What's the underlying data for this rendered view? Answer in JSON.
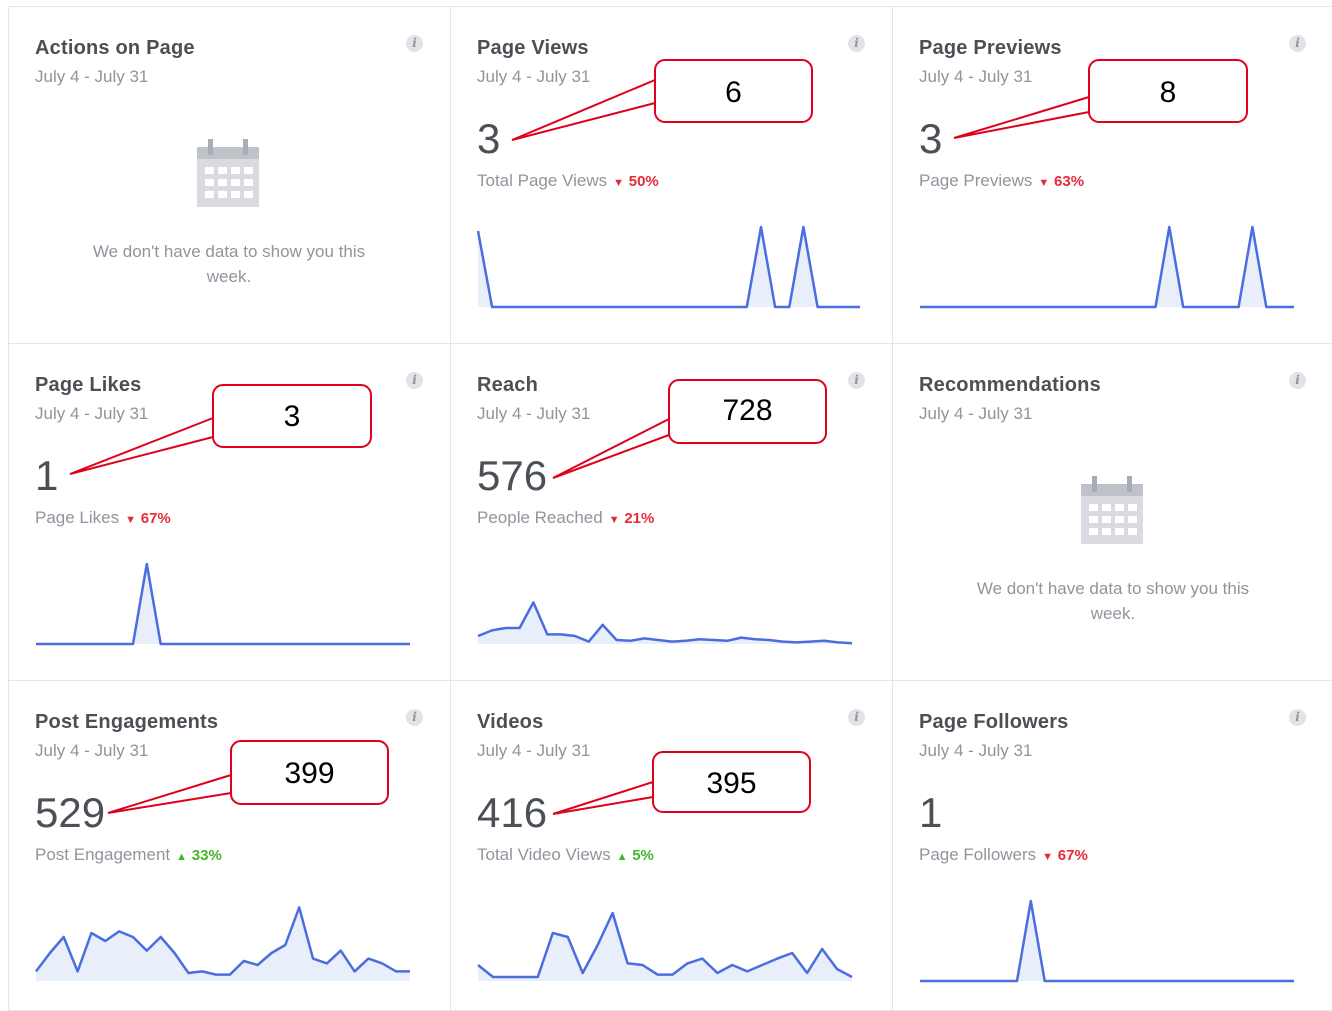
{
  "date_range": "July 4 - July 31",
  "info_glyph": "i",
  "empty_message": "We don't have data to show you this week.",
  "colors": {
    "line": "#4a6ee0",
    "down": "#e52b38",
    "up": "#42b72a",
    "callout": "#e0001b"
  },
  "cards": [
    {
      "id": "actions",
      "title": "Actions on Page",
      "empty": true
    },
    {
      "id": "views",
      "title": "Page Views",
      "value": "3",
      "metric": "Total Page Views",
      "direction": "down",
      "change": "50%",
      "series": [
        0.95,
        0,
        0,
        0,
        0,
        0,
        0,
        0,
        0,
        0,
        0,
        0,
        0,
        0,
        0,
        0,
        0,
        0,
        0,
        0,
        1,
        0,
        0,
        1,
        0,
        0,
        0,
        0
      ]
    },
    {
      "id": "previews",
      "title": "Page Previews",
      "value": "3",
      "metric": "Page Previews",
      "direction": "down",
      "change": "63%",
      "series": [
        0,
        0,
        0,
        0,
        0,
        0,
        0,
        0,
        0,
        0,
        0,
        0,
        0,
        0,
        0,
        0,
        0,
        0,
        1,
        0,
        0,
        0,
        0,
        0,
        1,
        0,
        0,
        0
      ]
    },
    {
      "id": "likes",
      "title": "Page Likes",
      "value": "1",
      "metric": "Page Likes",
      "direction": "down",
      "change": "67%",
      "series": [
        0,
        0,
        0,
        0,
        0,
        0,
        0,
        0,
        1,
        0,
        0,
        0,
        0,
        0,
        0,
        0,
        0,
        0,
        0,
        0,
        0,
        0,
        0,
        0,
        0,
        0,
        0,
        0
      ]
    },
    {
      "id": "reach",
      "title": "Reach",
      "value": "576",
      "metric": "People Reached",
      "direction": "down",
      "change": "21%",
      "series": [
        0.1,
        0.17,
        0.2,
        0.2,
        0.52,
        0.12,
        0.12,
        0.1,
        0.03,
        0.24,
        0.05,
        0.04,
        0.07,
        0.05,
        0.03,
        0.04,
        0.06,
        0.05,
        0.04,
        0.08,
        0.06,
        0.05,
        0.03,
        0.02,
        0.03,
        0.04,
        0.02,
        0.01
      ]
    },
    {
      "id": "recommendations",
      "title": "Recommendations",
      "empty": true
    },
    {
      "id": "engagements",
      "title": "Post Engagements",
      "value": "529",
      "metric": "Post Engagement",
      "direction": "up",
      "change": "33%",
      "series": [
        0.12,
        0.35,
        0.55,
        0.12,
        0.6,
        0.5,
        0.62,
        0.55,
        0.38,
        0.55,
        0.35,
        0.1,
        0.12,
        0.08,
        0.08,
        0.25,
        0.2,
        0.35,
        0.45,
        0.92,
        0.28,
        0.22,
        0.38,
        0.12,
        0.28,
        0.22,
        0.12,
        0.12
      ]
    },
    {
      "id": "videos",
      "title": "Videos",
      "value": "416",
      "metric": "Total Video Views",
      "direction": "up",
      "change": "5%",
      "series": [
        0.2,
        0.05,
        0.05,
        0.05,
        0.05,
        0.6,
        0.55,
        0.1,
        0.45,
        0.85,
        0.22,
        0.2,
        0.08,
        0.08,
        0.22,
        0.28,
        0.1,
        0.2,
        0.12,
        0.2,
        0.28,
        0.35,
        0.1,
        0.4,
        0.15,
        0.05
      ]
    },
    {
      "id": "followers",
      "title": "Page Followers",
      "value": "1",
      "metric": "Page Followers",
      "direction": "down",
      "change": "67%",
      "series": [
        0,
        0,
        0,
        0,
        0,
        0,
        0,
        0,
        1,
        0,
        0,
        0,
        0,
        0,
        0,
        0,
        0,
        0,
        0,
        0,
        0,
        0,
        0,
        0,
        0,
        0,
        0,
        0
      ]
    }
  ],
  "annotations": [
    "6",
    "8",
    "3",
    "728",
    "399",
    "395"
  ]
}
